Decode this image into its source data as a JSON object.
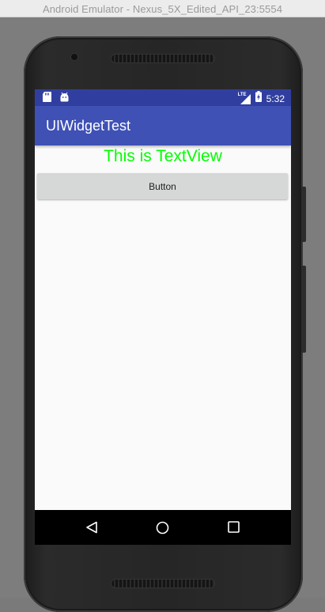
{
  "window": {
    "title": "Android Emulator - Nexus_5X_Edited_API_23:5554"
  },
  "status_bar": {
    "left_icons": [
      "sd-card-icon",
      "android-icon"
    ],
    "network_label": "LTE",
    "time": "5:32",
    "color": "#303f9f"
  },
  "app_bar": {
    "title": "UIWidgetTest",
    "color": "#3f51b5"
  },
  "content": {
    "text_view": "This is TextView",
    "text_view_color": "#00ff00",
    "button_label": "Button"
  },
  "nav_bar": {
    "buttons": [
      "back-icon",
      "home-icon",
      "recents-icon"
    ]
  }
}
